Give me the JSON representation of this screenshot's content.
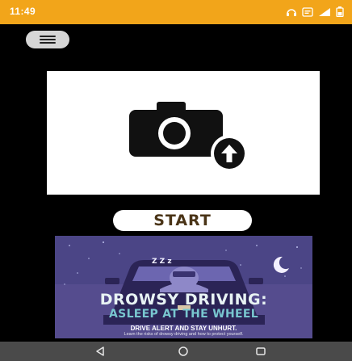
{
  "status_bar": {
    "time": "11:49",
    "background_color": "#f2a51a",
    "icons": [
      "headphones-icon",
      "notification-icon",
      "signal-icon",
      "battery-icon"
    ]
  },
  "menu": {
    "icon": "hamburger-menu-icon"
  },
  "image_panel": {
    "icon": "camera-upload-icon",
    "background_color": "#ffffff"
  },
  "start_button": {
    "label": "START",
    "text_color": "#4a3417"
  },
  "banner": {
    "title": "DROWSY DRIVING:",
    "subtitle": "ASLEEP AT THE WHEEL",
    "slogan": "DRIVE ALERT AND STAY UNHURT.",
    "note": "Learn the risks of drowsy driving and how to protect yourself.",
    "sleep_text": "Z Z z",
    "colors": {
      "background": "#554c8e",
      "title": "#e8f3f4",
      "subtitle": "#78c6cf"
    }
  },
  "nav_bar": {
    "icons": [
      "back-icon",
      "home-icon",
      "recents-icon"
    ],
    "background_color": "#4a4a4a"
  }
}
